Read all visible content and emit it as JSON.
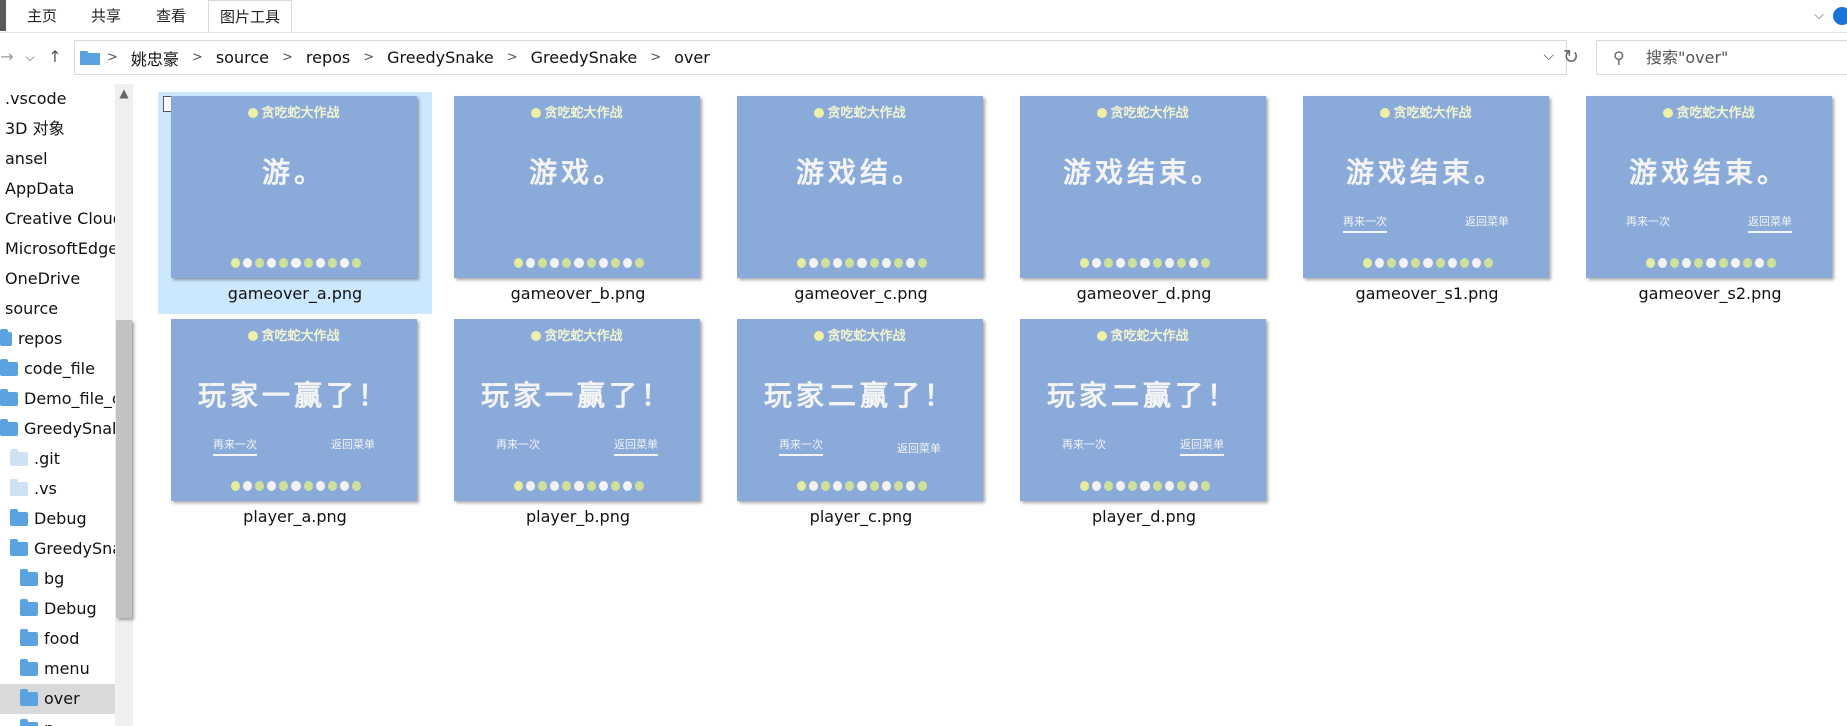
{
  "ribbon": {
    "tabs": [
      "主页",
      "共享",
      "查看",
      "图片工具"
    ]
  },
  "address": {
    "crumbs": [
      "姚忠豪",
      "source",
      "repos",
      "GreedySnake",
      "GreedySnake",
      "over"
    ]
  },
  "search": {
    "placeholder": "搜索\"over\""
  },
  "sidebar": {
    "items": [
      {
        "label": ".vscode",
        "icon": "none"
      },
      {
        "label": "3D 对象",
        "icon": "none"
      },
      {
        "label": "ansel",
        "icon": "none"
      },
      {
        "label": "AppData",
        "icon": "none"
      },
      {
        "label": "Creative Cloud",
        "icon": "none"
      },
      {
        "label": "MicrosoftEdge",
        "icon": "none"
      },
      {
        "label": "OneDrive",
        "icon": "none"
      },
      {
        "label": "source",
        "icon": "none"
      },
      {
        "label": "repos",
        "icon": "folder"
      },
      {
        "label": "code_file",
        "icon": "folder"
      },
      {
        "label": "Demo_file_c",
        "icon": "folder"
      },
      {
        "label": "GreedySnake",
        "icon": "folder"
      },
      {
        "label": ".git",
        "icon": "folder-pale"
      },
      {
        "label": ".vs",
        "icon": "folder-pale"
      },
      {
        "label": "Debug",
        "icon": "folder"
      },
      {
        "label": "GreedySna",
        "icon": "folder"
      },
      {
        "label": "bg",
        "icon": "folder"
      },
      {
        "label": "Debug",
        "icon": "folder"
      },
      {
        "label": "food",
        "icon": "folder"
      },
      {
        "label": "menu",
        "icon": "folder"
      },
      {
        "label": "over",
        "icon": "folder",
        "selected": true
      },
      {
        "label": "p",
        "icon": "folder"
      }
    ]
  },
  "files": [
    {
      "name": "gameover_a.png",
      "title": "贪吃蛇大作战",
      "text": "游。",
      "left": "",
      "right": "",
      "underline": ""
    },
    {
      "name": "gameover_b.png",
      "title": "贪吃蛇大作战",
      "text": "游戏。",
      "left": "",
      "right": "",
      "underline": ""
    },
    {
      "name": "gameover_c.png",
      "title": "贪吃蛇大作战",
      "text": "游戏结。",
      "left": "",
      "right": "",
      "underline": ""
    },
    {
      "name": "gameover_d.png",
      "title": "贪吃蛇大作战",
      "text": "游戏结束。",
      "left": "",
      "right": "",
      "underline": ""
    },
    {
      "name": "gameover_s1.png",
      "title": "贪吃蛇大作战",
      "text": "游戏结束。",
      "left": "再来一次",
      "right": "返回菜单",
      "underline": "left"
    },
    {
      "name": "gameover_s2.png",
      "title": "贪吃蛇大作战",
      "text": "游戏结束。",
      "left": "再来一次",
      "right": "返回菜单",
      "underline": "right"
    },
    {
      "name": "player_a.png",
      "title": "贪吃蛇大作战",
      "text": "玩家一赢了！",
      "left": "再来一次",
      "right": "返回菜单",
      "underline": "left"
    },
    {
      "name": "player_b.png",
      "title": "贪吃蛇大作战",
      "text": "玩家一赢了！",
      "left": "再来一次",
      "right": "返回菜单",
      "underline": "right"
    },
    {
      "name": "player_c.png",
      "title": "贪吃蛇大作战",
      "text": "玩家二赢了！",
      "left": "再来一次",
      "right": "返回菜单",
      "underline": "left"
    },
    {
      "name": "player_d.png",
      "title": "贪吃蛇大作战",
      "text": "玩家二赢了！",
      "left": "再来一次",
      "right": "返回菜单",
      "underline": "right"
    }
  ]
}
